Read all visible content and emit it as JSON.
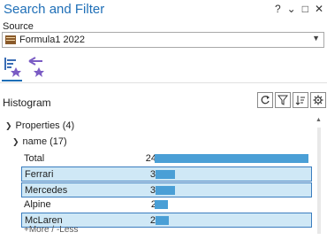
{
  "window": {
    "title": "Search and Filter"
  },
  "controls": {
    "help": "?",
    "menu": "⌄",
    "restore": "□",
    "close": "✕"
  },
  "source": {
    "label": "Source",
    "value": "Formula1 2022"
  },
  "histogram": {
    "title": "Histogram"
  },
  "tree": {
    "properties_label": "Properties",
    "properties_count": "(4)",
    "name_label": "name",
    "name_count": "(17)"
  },
  "rows": [
    {
      "label": "Total",
      "count": "24",
      "value": 24,
      "selected": false
    },
    {
      "label": "Ferrari",
      "count": "3",
      "value": 3,
      "selected": true
    },
    {
      "label": "Mercedes",
      "count": "3",
      "value": 3,
      "selected": true
    },
    {
      "label": "Alpine",
      "count": "2",
      "value": 2,
      "selected": false
    },
    {
      "label": "McLaren",
      "count": "2",
      "value": 2,
      "selected": true
    }
  ],
  "more_less": "+More / -Less",
  "colors": {
    "accent": "#1f6fb7",
    "bar": "#4a9fd6",
    "selected_bg": "#cfe8f6"
  }
}
